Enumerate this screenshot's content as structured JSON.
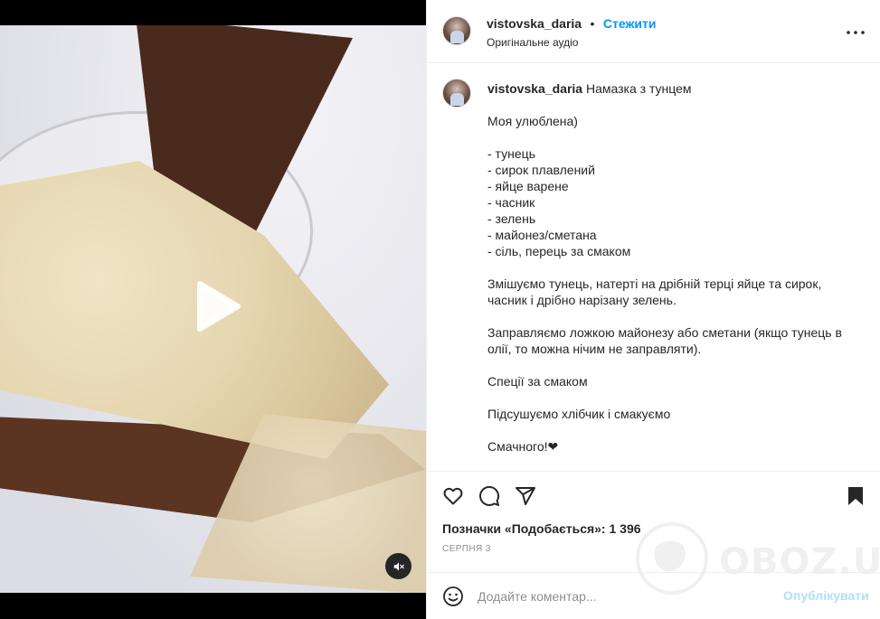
{
  "header": {
    "username": "vistovska_daria",
    "separator": "•",
    "follow_label": "Стежити",
    "audio_label": "Оригінальне аудіо",
    "more_icon": "more-horizontal-icon"
  },
  "caption": {
    "username": "vistovska_daria",
    "title": "Намазка з тунцем",
    "body": "Моя улюблена)\n\n- тунець\n- сирок плавлений\n- яйце варене\n- часник\n- зелень\n- майонез/сметана\n- сіль, перець за смаком\n\nЗмішуємо тунець, натерті на дрібній терці яйце та сирок, часник і дрібно нарізану зелень.\n\nЗаправляємо ложкою майонезу або сметани (якщо тунець в олії, то можна нічим не заправляти).\n\nСпеції за смаком\n\nПідсушуємо хлібчик і смакуємо\n\nСмачного!❤"
  },
  "actions": {
    "icons": [
      "heart-icon",
      "comment-icon",
      "share-icon",
      "bookmark-icon"
    ],
    "likes_label": "Позначки «Подобається»: 1 396",
    "date": "СЕРПНЯ 3"
  },
  "comment_bar": {
    "emoji_icon": "emoji-icon",
    "placeholder": "Додайте коментар...",
    "publish_label": "Опублікувати"
  },
  "media": {
    "play_icon": "play-icon",
    "mute_icon": "muted-speaker-icon"
  },
  "watermark": {
    "text": "OBOZ.UA"
  },
  "colors": {
    "accent": "#0095f6",
    "publish_disabled": "#b2dffc",
    "text": "#262626",
    "muted": "#8e8e8e",
    "border": "#efefef"
  }
}
